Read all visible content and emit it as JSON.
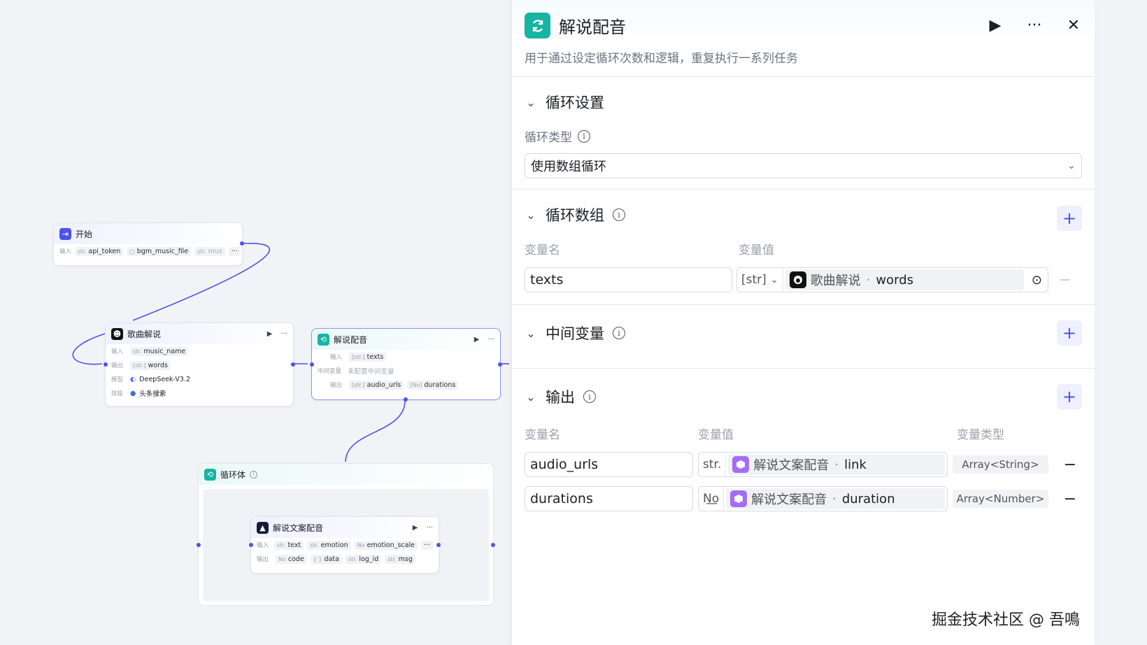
{
  "canvas": {
    "start_node": {
      "title": "开始",
      "input_label": "输入",
      "inputs": [
        {
          "type": "str.",
          "name": "api_token"
        },
        {
          "type": "□",
          "name": "bgm_music_file"
        },
        {
          "type": "str.",
          "name": "mus"
        }
      ],
      "more": "···"
    },
    "song_node": {
      "title": "歌曲解说",
      "rows": [
        {
          "label": "输入",
          "type": "str.",
          "value": "music_name"
        },
        {
          "label": "输出",
          "type": "[str.]",
          "value": "words"
        },
        {
          "label": "模型",
          "type": "",
          "value": "DeepSeek-V3.2"
        },
        {
          "label": "技能",
          "type": "",
          "value": "头条搜索"
        }
      ]
    },
    "dub_node": {
      "title": "解说配音",
      "input_label": "输入",
      "input_type": "[str.]",
      "input_value": "texts",
      "mid_label": "中间变量",
      "mid_value": "未配置中间变量",
      "output_label": "输出",
      "outputs": [
        {
          "type": "[str.]",
          "name": "audio_urls"
        },
        {
          "type": "[No]",
          "name": "durations"
        }
      ]
    },
    "loop_body": {
      "title": "循环体"
    },
    "tts_node": {
      "title": "解说文案配音",
      "input_label": "输入",
      "inputs": [
        {
          "type": "str.",
          "name": "text"
        },
        {
          "type": "str.",
          "name": "emotion"
        },
        {
          "type": "No",
          "name": "emotion_scale"
        }
      ],
      "output_label": "输出",
      "outputs": [
        {
          "type": "No",
          "name": "code"
        },
        {
          "type": "{ }",
          "name": "data"
        },
        {
          "type": "str.",
          "name": "log_id"
        },
        {
          "type": "str.",
          "name": "msg"
        }
      ],
      "more": "···"
    }
  },
  "panel": {
    "title": "解说配音",
    "description": "用于通过设定循环次数和逻辑，重复执行一系列任务",
    "actions": {
      "run": "▶",
      "more": "···",
      "close": "✕"
    },
    "loop_settings": {
      "title": "循环设置",
      "type_label": "循环类型",
      "type_value": "使用数组循环"
    },
    "loop_array": {
      "title": "循环数组",
      "col_name": "变量名",
      "col_value": "变量值",
      "rows": [
        {
          "name": "texts",
          "type": "[str]",
          "node": "歌曲解说",
          "field": "words"
        }
      ]
    },
    "intermediate": {
      "title": "中间变量"
    },
    "output": {
      "title": "输出",
      "col_name": "变量名",
      "col_value": "变量值",
      "col_type": "变量类型",
      "rows": [
        {
          "name": "audio_urls",
          "type": "str.",
          "node": "解说文案配音",
          "field": "link",
          "vartype": "Array<String>"
        },
        {
          "name": "durations",
          "type": "N͟o",
          "node": "解说文案配音",
          "field": "duration",
          "vartype": "Array<Number>"
        }
      ]
    }
  },
  "watermark": "掘金技术社区 @ 吾鳴",
  "colors": {
    "accent": "#4d53e8",
    "loop_teal": "#17b3a3",
    "plugin_purple": "#a46df7"
  }
}
